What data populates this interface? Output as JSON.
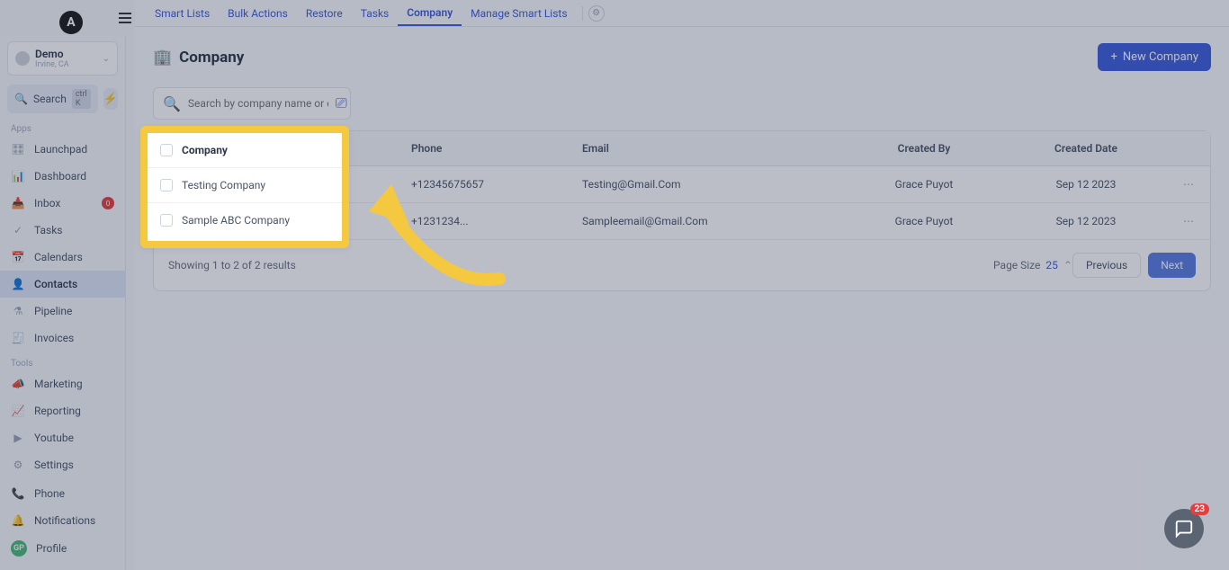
{
  "avatar_letter": "A",
  "location": {
    "name": "Demo",
    "sub": "Irvine, CA"
  },
  "sidebar": {
    "search_label": "Search",
    "search_kbd": "ctrl K",
    "apps_label": "Apps",
    "tools_label": "Tools",
    "items_apps": [
      {
        "label": "Launchpad"
      },
      {
        "label": "Dashboard"
      },
      {
        "label": "Inbox",
        "badge": "0"
      },
      {
        "label": "Tasks"
      },
      {
        "label": "Calendars"
      },
      {
        "label": "Contacts",
        "active": true
      },
      {
        "label": "Pipeline"
      },
      {
        "label": "Invoices"
      }
    ],
    "items_tools": [
      {
        "label": "Marketing"
      },
      {
        "label": "Reporting"
      },
      {
        "label": "Youtube"
      },
      {
        "label": "Settings"
      }
    ],
    "bottom": [
      {
        "label": "Phone"
      },
      {
        "label": "Notifications"
      },
      {
        "label": "Profile",
        "avatar": "GP"
      }
    ]
  },
  "tabs": [
    "Smart Lists",
    "Bulk Actions",
    "Restore",
    "Tasks",
    "Company",
    "Manage Smart Lists"
  ],
  "active_tab": "Company",
  "page_title": "Company",
  "new_company_label": "New Company",
  "search_placeholder": "Search by company name or email",
  "columns": [
    "Company",
    "Phone",
    "Email",
    "Created By",
    "Created Date"
  ],
  "rows": [
    {
      "company": "Testing Company",
      "phone": "+12345675657",
      "email": "Testing@Gmail.Com",
      "created_by": "Grace Puyot",
      "created_date": "Sep 12 2023"
    },
    {
      "company": "Sample ABC Company",
      "phone": "+1231234...",
      "email": "Sampleemail@Gmail.Com",
      "created_by": "Grace Puyot",
      "created_date": "Sep 12 2023"
    }
  ],
  "footer": {
    "results": "Showing 1 to 2 of 2 results",
    "page_size_label": "Page Size",
    "page_size_value": "25",
    "prev": "Previous",
    "next": "Next"
  },
  "chat_badge": "23"
}
